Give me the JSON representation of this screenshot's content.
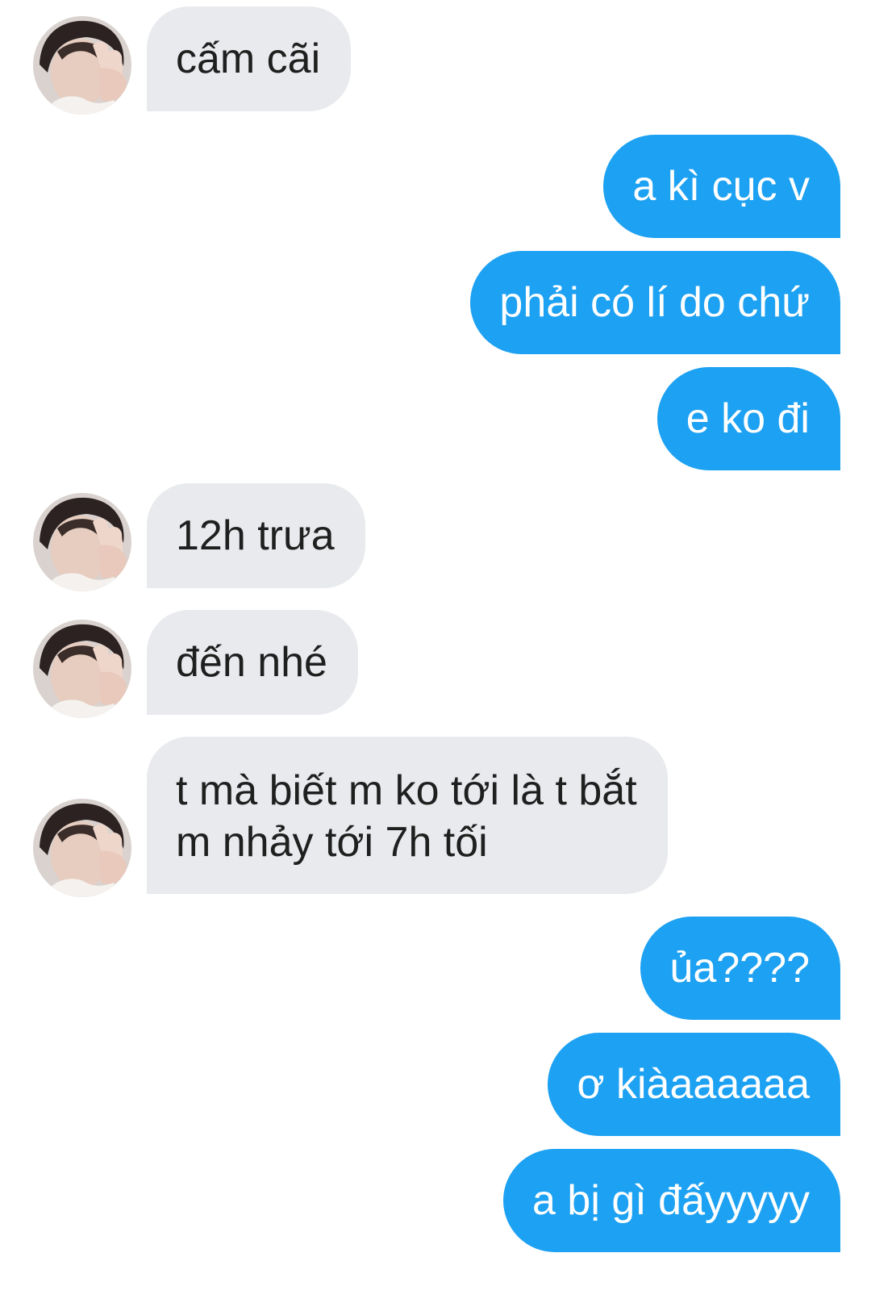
{
  "messages": [
    {
      "direction": "received",
      "text": "cấm cãi"
    },
    {
      "direction": "sent",
      "text": "a kì cục v"
    },
    {
      "direction": "sent",
      "text": "phải có lí do chứ"
    },
    {
      "direction": "sent",
      "text": "e ko đi"
    },
    {
      "direction": "received",
      "text": "12h trưa"
    },
    {
      "direction": "received",
      "text": "đến nhé"
    },
    {
      "direction": "received",
      "text": "t mà biết m ko tới là t bắt\nm nhảy tới 7h tối"
    },
    {
      "direction": "sent",
      "text": "ủa????"
    },
    {
      "direction": "sent",
      "text": "ơ kiàaaaaaa"
    },
    {
      "direction": "sent",
      "text": "a bị gì đấyyyyy"
    }
  ],
  "colors": {
    "sent_bubble": "#1da1f2",
    "received_bubble": "#e8eaed",
    "sent_text": "#ffffff",
    "received_text": "#1f1f1f"
  },
  "icons": {
    "avatar": "user-avatar-photo-peace-sign"
  }
}
